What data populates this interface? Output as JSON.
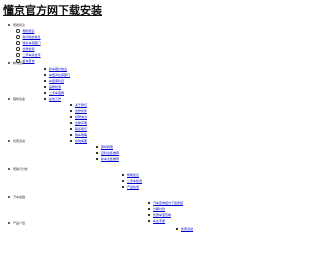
{
  "site": {
    "title": "懂京官方网下载安装"
  },
  "sections": [
    {
      "label": "帮助建议",
      "links": [
        "帮助建议",
        "新闻动态信息",
        "特价车源部门",
        "优质检测",
        "二手车综合评",
        "检车查询"
      ]
    },
    {
      "label": "精准选车",
      "links": [
        "新车报价信息",
        "车型对比库部门",
        "车型库科目",
        "品质检测",
        "二手车官网",
        "在线工作"
      ]
    },
    {
      "label": "理财资金",
      "links": [
        "关于我们",
        "合作伙伴",
        "招聘信息",
        "法律声明",
        "联系我们",
        "购车攻略",
        "在线客服"
      ]
    },
    {
      "label": "优惠活动",
      "links": [
        "限时特惠",
        "百科全集推荐",
        "新车全集推荐"
      ]
    },
    {
      "label": "帮助与分析",
      "links": [
        "帮助建议",
        "二手车检测",
        "产品检测"
      ]
    },
    {
      "label": "汽车金融",
      "links": [
        "汽车查询官方下载安装",
        "分期付款",
        "优惠车型查看",
        "车主手册"
      ]
    },
    {
      "label": "产品介绍",
      "links": [
        "优惠活动"
      ]
    }
  ]
}
